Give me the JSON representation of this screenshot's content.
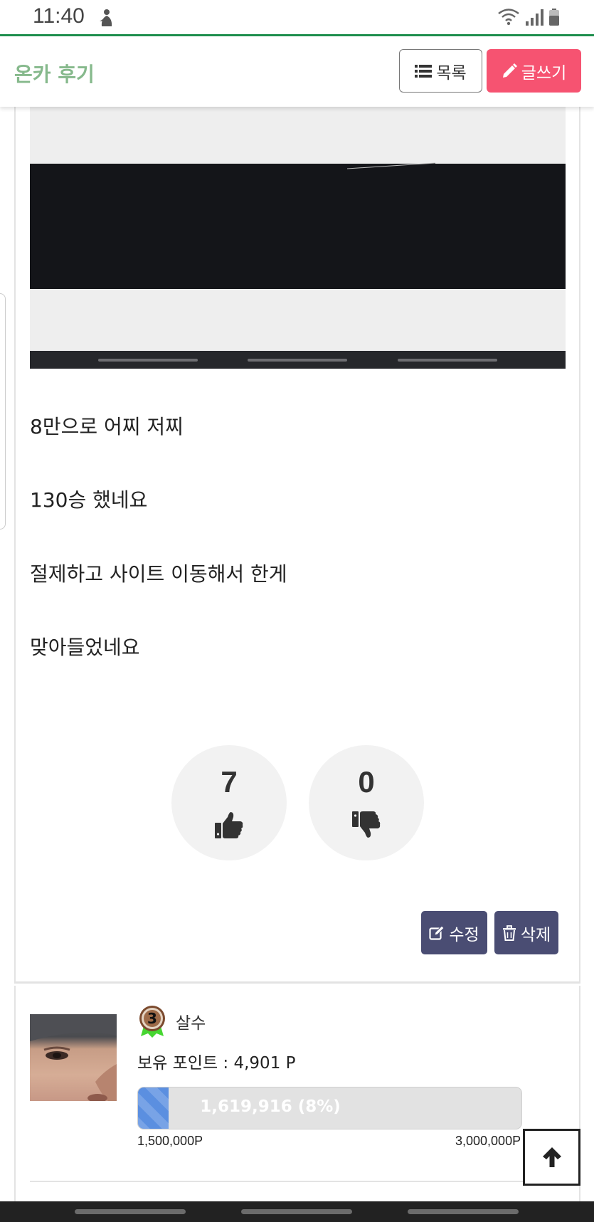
{
  "status_bar": {
    "time": "11:40",
    "person_icon": "person-silhouette-icon",
    "right_icons": [
      "wifi-icon",
      "signal-icon",
      "battery-icon"
    ]
  },
  "header": {
    "title": "온카 후기",
    "list_button": {
      "label": "목록",
      "icon": "list-icon"
    },
    "write_button": {
      "label": "글쓰기",
      "icon": "pencil-icon"
    }
  },
  "post": {
    "lines": [
      "8만으로 어찌 저찌",
      "130승  했네요",
      "절제하고 사이트 이동해서 한게",
      "맞아들었네요"
    ]
  },
  "votes": {
    "up": {
      "count": "7",
      "icon": "thumbs-up-icon"
    },
    "down": {
      "count": "0",
      "icon": "thumbs-down-icon"
    }
  },
  "actions": {
    "edit": {
      "label": "수정",
      "icon": "edit-icon"
    },
    "delete": {
      "label": "삭제",
      "icon": "trash-icon"
    }
  },
  "author": {
    "level": "3",
    "name": "살수",
    "points_text": "보유 포인트 : 4,901 P",
    "progress": {
      "label": "1,619,916 (8%)",
      "fraction": 0.08,
      "min": "1,500,000P",
      "max": "3,000,000P"
    }
  },
  "colors": {
    "accent_green": "#86b98c",
    "write_button": "#f65371",
    "action_button": "#4a4d73",
    "progress": "#5b8fe0"
  }
}
